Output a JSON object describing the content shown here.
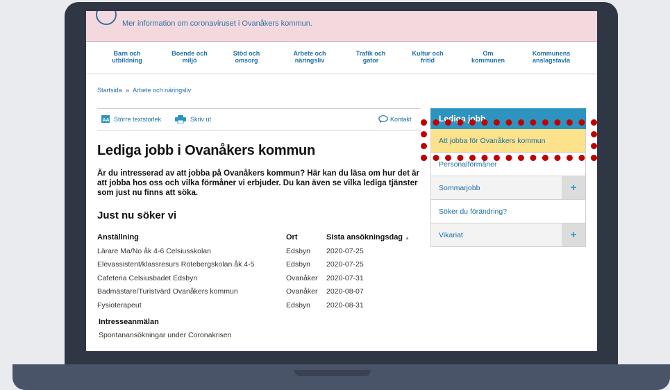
{
  "banner": {
    "text": "Mer information om coronaviruset i Ovanåkers kommun."
  },
  "nav": [
    {
      "line1": "Barn och",
      "line2": "utbildning"
    },
    {
      "line1": "Boende och",
      "line2": "miljö"
    },
    {
      "line1": "Stöd och",
      "line2": "omsorg"
    },
    {
      "line1": "Arbete och",
      "line2": "näringsliv"
    },
    {
      "line1": "Trafik och",
      "line2": "gator"
    },
    {
      "line1": "Kultur och",
      "line2": "fritid"
    },
    {
      "line1": "Om",
      "line2": "kommunen"
    },
    {
      "line1": "Kommunens",
      "line2": "anslagstavla"
    }
  ],
  "breadcrumb": {
    "home": "Startsida",
    "separator": "»",
    "current": "Arbete och näringsliv"
  },
  "toolbar": {
    "text_size": "Större textstorlek",
    "print": "Skriv ut",
    "contact": "Kontakt"
  },
  "page": {
    "title": "Lediga jobb i Ovanåkers kommun",
    "intro": "Är du intresserad av att jobba på Ovanåkers kommun? Här kan du läsa om hur det är att jobba hos oss och vilka förmåner vi erbjuder. Du kan även se vilka lediga tjänster som just nu finns att söka.",
    "section_title": "Just nu söker vi"
  },
  "jobs": {
    "columns": [
      "Anställning",
      "Ort",
      "Sista ansökningsdag"
    ],
    "sort_icon": "▲",
    "rows": [
      [
        "Lärare Ma/No åk 4-6 Celsiusskolan",
        "Edsbyn",
        "2020-07-25"
      ],
      [
        "Elevassistent/klassresurs Rotebergskolan åk 4-5",
        "Edsbyn",
        "2020-07-25"
      ],
      [
        "Cafeteria Celsiusbadet Edsbyn",
        "Ovanåker",
        "2020-07-31"
      ],
      [
        "Badmästare/Turistvärd Ovanåkers kommun",
        "Ovanåker",
        "2020-08-07"
      ],
      [
        "Fysioterapeut",
        "Edsbyn",
        "2020-08-31"
      ]
    ]
  },
  "interest": {
    "title": "Intresseanmälan",
    "link": "Spontanansökningar under Coronakrisen"
  },
  "sidebar": {
    "title": "Lediga jobb",
    "items": [
      {
        "label": "Att jobba för Ovanåkers kommun"
      },
      {
        "label": "Personalförmåner"
      },
      {
        "label": "Sommarjobb",
        "expand": "+"
      },
      {
        "label": "Söker du förändring?"
      },
      {
        "label": "Vikariat",
        "expand": "+"
      }
    ]
  },
  "colors": {
    "accent": "#2d94c0",
    "link": "#1d6fa5",
    "active_item": "#fce28a",
    "highlight": "#c10000",
    "banner": "#f3d9de"
  }
}
